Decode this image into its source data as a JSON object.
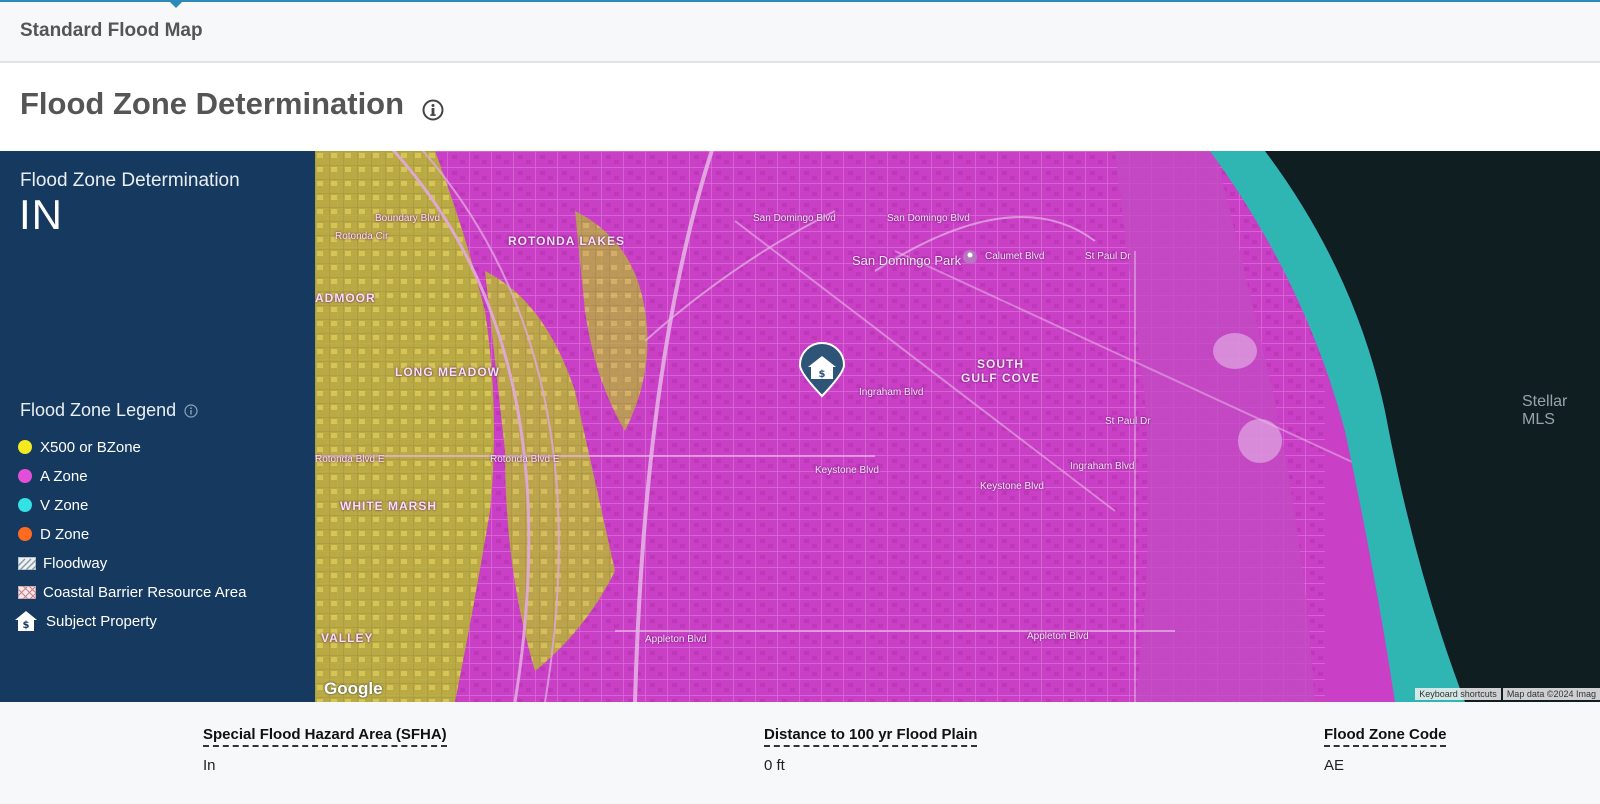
{
  "tab": {
    "title": "Standard Flood Map"
  },
  "page": {
    "title": "Flood Zone Determination"
  },
  "panel": {
    "label": "Flood Zone Determination",
    "value": "IN",
    "legend_title": "Flood Zone Legend",
    "legend": [
      {
        "label": "X500 or BZone",
        "color": "#f4ea1f"
      },
      {
        "label": "A Zone",
        "color": "#e34fd9"
      },
      {
        "label": "V Zone",
        "color": "#34e2e6"
      },
      {
        "label": "D Zone",
        "color": "#ff6a1f"
      },
      {
        "label": "Floodway",
        "icon": "hatch-icon"
      },
      {
        "label": "Coastal Barrier Resource Area",
        "icon": "crosshatch-icon"
      },
      {
        "label": "Subject Property",
        "icon": "house-dollar-icon"
      }
    ]
  },
  "map": {
    "labels": [
      "ROTONDA LAKES",
      "ADMOOR",
      "LONG MEADOW",
      "WHITE MARSH",
      "VALLEY",
      "SOUTH",
      "GULF COVE",
      "San Domingo Park",
      "San Domingo Blvd",
      "San Domingo Blvd",
      "Calumet Blvd",
      "Ingraham Blvd",
      "Keystone Blvd",
      "Keystone Blvd",
      "Ingraham Blvd",
      "Appleton Blvd",
      "Appleton Blvd",
      "Rotonda Blvd E",
      "Rotonda Blvd E",
      "St Paul Dr",
      "St Paul Dr",
      "Boundary Blvd",
      "Rotonda Cir"
    ],
    "watermark": "Stellar MLS",
    "google": "Google",
    "attribution": [
      "Keyboard shortcuts",
      "Map data ©2024 Imag"
    ],
    "colors": {
      "a_zone": "#c93fc6",
      "x_zone": "#c8c638",
      "v_zone": "#2fb6b3",
      "ocean": "#0e1e21"
    }
  },
  "metrics": [
    {
      "label": "Special Flood Hazard Area (SFHA)",
      "value": "In"
    },
    {
      "label": "Distance to 100 yr Flood Plain",
      "value": "0 ft"
    },
    {
      "label": "Flood Zone Code",
      "value": "AE"
    }
  ]
}
